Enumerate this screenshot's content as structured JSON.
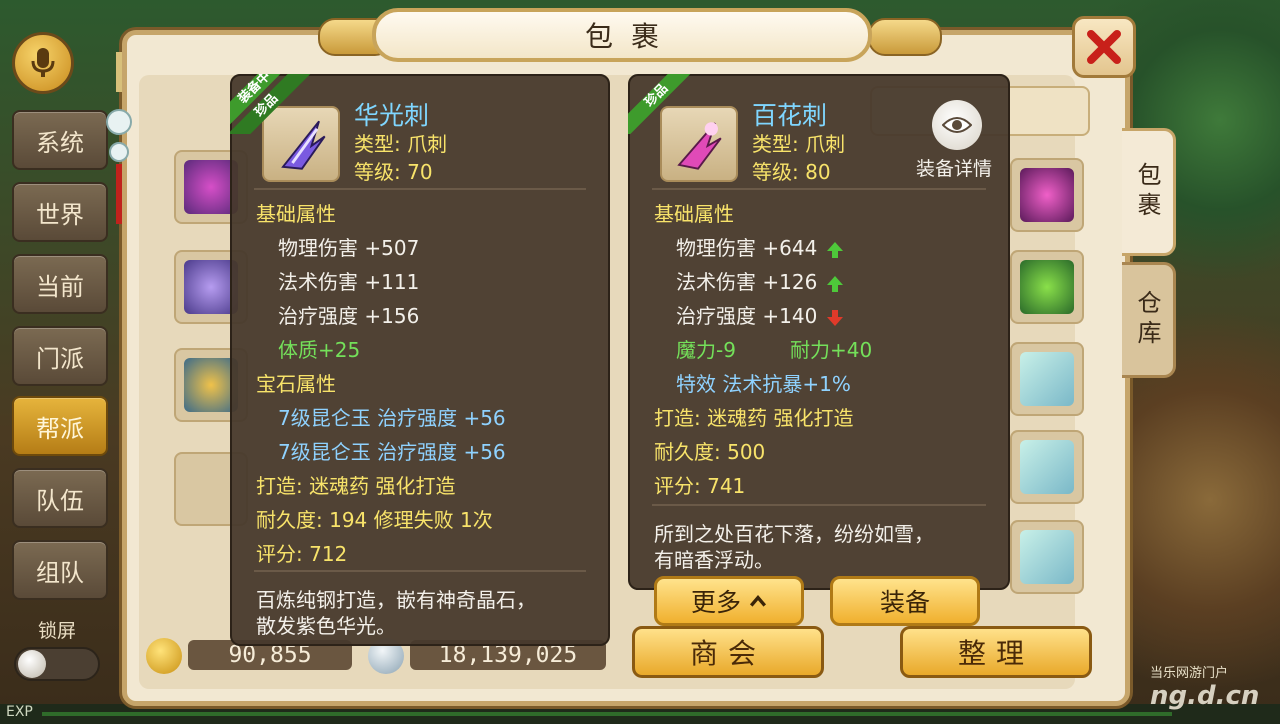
{
  "channels": [
    "系统",
    "世界",
    "当前",
    "门派",
    "帮派",
    "队伍",
    "组队"
  ],
  "lock_label": "锁屏",
  "exp_label": "EXP",
  "window": {
    "title": "包裹",
    "tabs": [
      "包裹",
      "仓库"
    ]
  },
  "currency": {
    "gold": "90,855",
    "silver": "18,139,025"
  },
  "buttons": {
    "shop": "商会",
    "sort": "整理"
  },
  "left": {
    "ribbon_top": "装备中",
    "ribbon_bottom": "珍品",
    "name": "华光刺",
    "type": "类型: 爪刺",
    "level": "等级: 70",
    "base_heading": "基础属性",
    "attrs": [
      "物理伤害  +507",
      "法术伤害  +111",
      "治疗强度  +156"
    ],
    "bonus": "体质+25",
    "gem_heading": "宝石属性",
    "gems": [
      "7级昆仑玉  治疗强度  +56",
      "7级昆仑玉  治疗强度  +56"
    ],
    "forge": "打造: 迷魂药   强化打造",
    "durability": "耐久度: 194  修理失败  1次",
    "score": "评分: 712",
    "desc": [
      "百炼纯钢打造，嵌有神奇晶石，",
      "散发紫色华光。"
    ]
  },
  "right": {
    "ribbon": "珍品",
    "name": "百花刺",
    "type": "类型: 爪刺",
    "level": "等级: 80",
    "detail_label": "装备详情",
    "base_heading": "基础属性",
    "attrs": [
      {
        "text": "物理伤害 +644",
        "trend": "up"
      },
      {
        "text": "法术伤害 +126",
        "trend": "up"
      },
      {
        "text": "治疗强度 +140",
        "trend": "down"
      }
    ],
    "bonus": [
      "魔力-9",
      "耐力+40"
    ],
    "effect": "特效  法术抗暴+1%",
    "forge": "打造: 迷魂药   强化打造",
    "durability": "耐久度: 500",
    "score": "评分: 741",
    "desc": [
      "所到之处百花下落，纷纷如雪，",
      "有暗香浮动。"
    ],
    "more_label": "更多",
    "equip_label": "装备"
  },
  "watermark": {
    "top": "当乐网游门户",
    "domain": "ng.d.cn"
  },
  "colors": {
    "accent": "#f8e36a",
    "name": "#7fd6ff",
    "bonus": "#74e05a",
    "up": "#4ec83a",
    "down": "#e03a2a"
  }
}
